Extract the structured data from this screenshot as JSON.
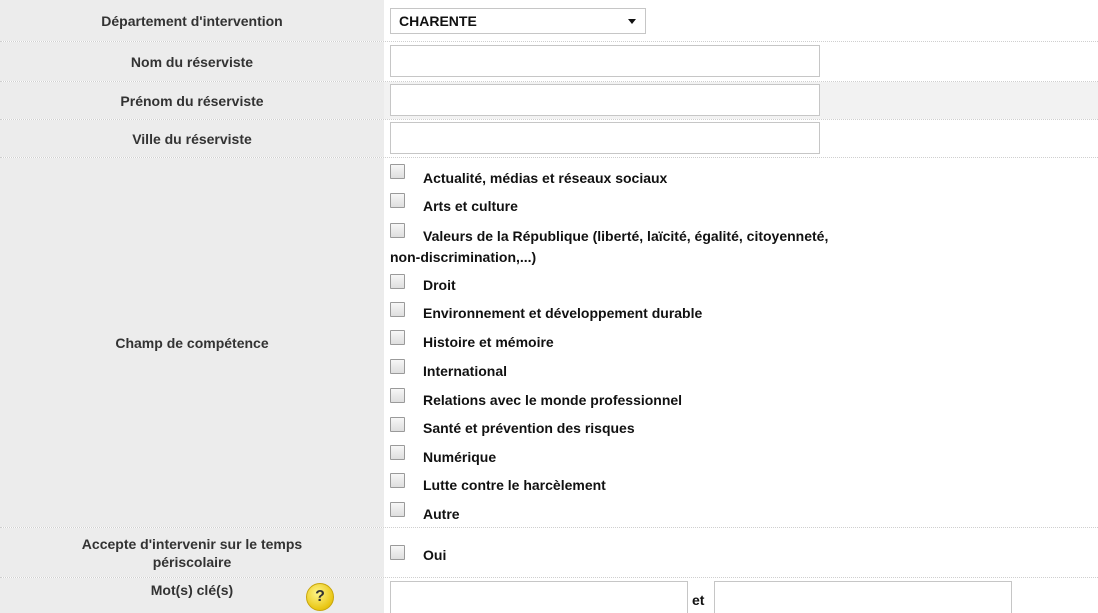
{
  "departement": {
    "label": "Département d'intervention",
    "selected": "CHARENTE"
  },
  "nom": {
    "label": "Nom du réserviste",
    "value": ""
  },
  "prenom": {
    "label": "Prénom du réserviste",
    "value": ""
  },
  "ville": {
    "label": "Ville du réserviste",
    "value": ""
  },
  "competence": {
    "label": "Champ de compétence",
    "options": [
      "Actualité, médias et réseaux sociaux",
      "Arts et culture",
      "Valeurs de la République (liberté, laïcité, égalité, citoyenneté,",
      "non-discrimination,...)",
      "Droit",
      "Environnement et développement durable",
      "Histoire et mémoire",
      "International",
      "Relations avec le monde professionnel",
      "Santé et prévention des risques",
      "Numérique",
      "Lutte contre le harcèlement",
      "Autre"
    ]
  },
  "periscolaire": {
    "label": "Accepte d'intervenir sur le temps périscolaire",
    "option": "Oui"
  },
  "motscles": {
    "label": "Mot(s) clé(s)",
    "help": "?",
    "joiner": "et",
    "value1": "",
    "value2": ""
  },
  "icons": {
    "help": "question-icon",
    "dropdown": "chevron-down-icon"
  }
}
